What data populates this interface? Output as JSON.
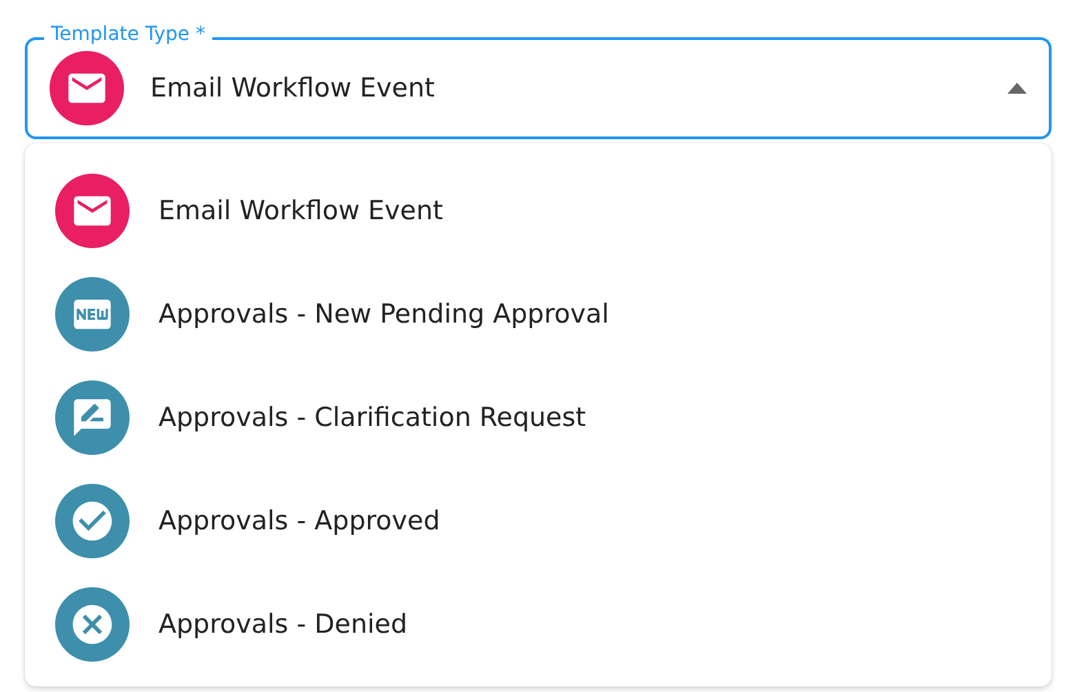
{
  "field": {
    "label": "Template Type *",
    "value": "Email Workflow Event",
    "kind": "email",
    "color": "#e91e63",
    "expanded": true
  },
  "menu": {
    "items": [
      {
        "label": "Email Workflow Event",
        "kind": "email",
        "color": "#e91e63"
      },
      {
        "label": "Approvals - New Pending Approval",
        "kind": "new",
        "color": "#3d8fab"
      },
      {
        "label": "Approvals - Clarification Request",
        "kind": "comment",
        "color": "#3d8fab"
      },
      {
        "label": "Approvals - Approved",
        "kind": "check",
        "color": "#3d8fab"
      },
      {
        "label": "Approvals - Denied",
        "kind": "cancel",
        "color": "#3d8fab"
      }
    ]
  }
}
